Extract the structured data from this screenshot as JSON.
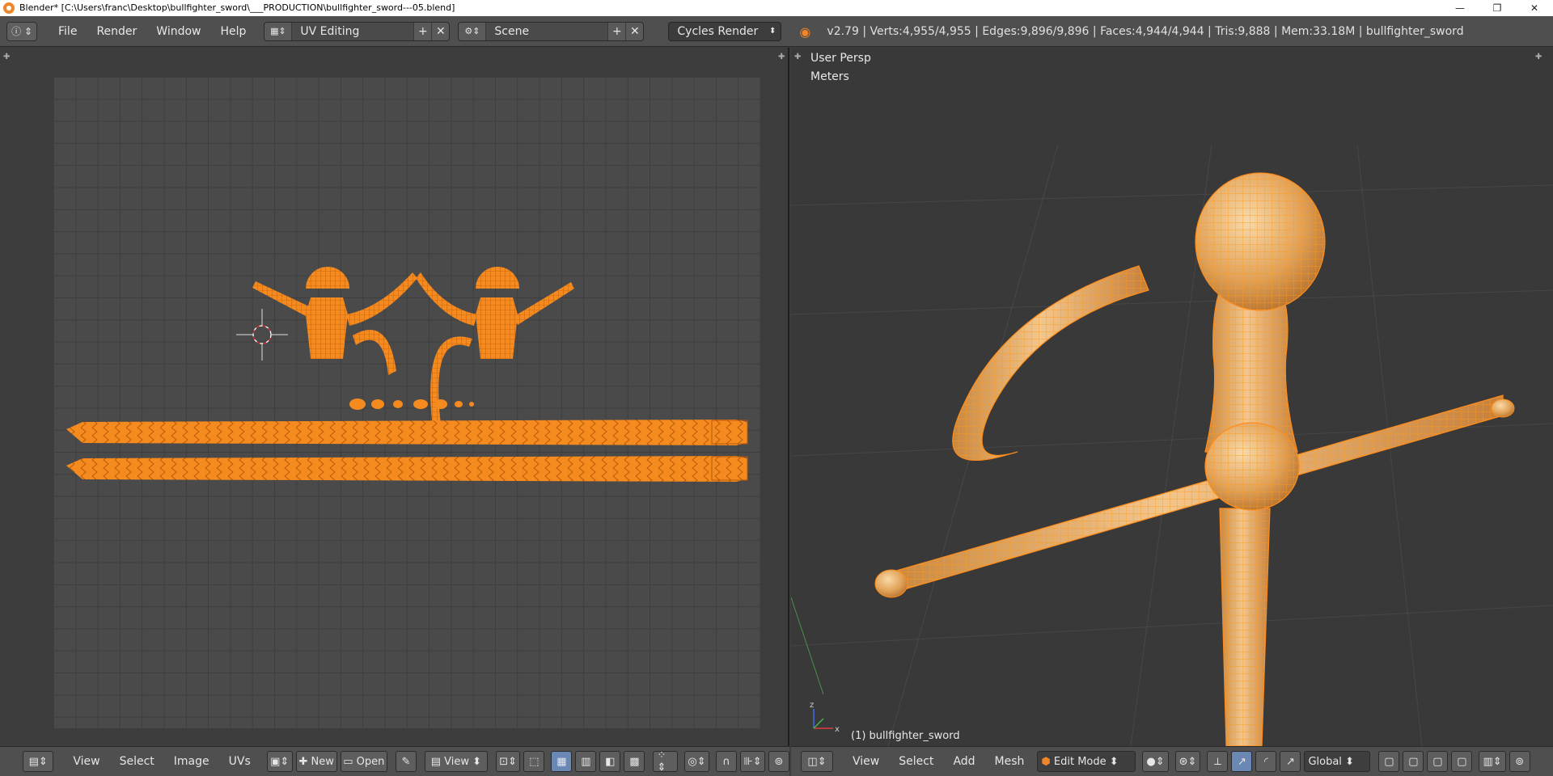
{
  "titlebar": {
    "title": "Blender* [C:\\Users\\franc\\Desktop\\bullfighter_sword\\___PRODUCTION\\bullfighter_sword---05.blend]",
    "minimize": "—",
    "restore": "❐",
    "close": "✕"
  },
  "header": {
    "menus": [
      "File",
      "Render",
      "Window",
      "Help"
    ],
    "screen_layout": "UV Editing",
    "scene": "Scene",
    "render_engine": "Cycles Render",
    "stats": "v2.79 | Verts:4,955/4,955 | Edges:9,896/9,896 | Faces:4,944/4,944 | Tris:9,888 | Mem:33.18M | bullfighter_sword"
  },
  "viewport3d": {
    "view_name": "User Persp",
    "units": "Meters",
    "object_label": "(1) bullfighter_sword"
  },
  "uv_footer": {
    "menus": [
      "View",
      "Select",
      "Image",
      "UVs"
    ],
    "new_label": "New",
    "open_label": "Open",
    "view_label": "View"
  },
  "view3d_footer": {
    "menus": [
      "View",
      "Select",
      "Add",
      "Mesh"
    ],
    "mode": "Edit Mode",
    "orientation": "Global"
  },
  "colors": {
    "accent": "#f0862a",
    "wire": "#ff8c1a",
    "mesh_fill": "#e3a45c"
  },
  "icons": {
    "app": "blender-logo-icon",
    "info": "info-icon",
    "layout": "screen-layout-icon",
    "scene": "scene-icon",
    "image": "image-icon",
    "cursor": "cursor-icon",
    "pivot": "pivot-icon",
    "snap": "snap-icon",
    "manipulator": "manipulator-icon"
  }
}
